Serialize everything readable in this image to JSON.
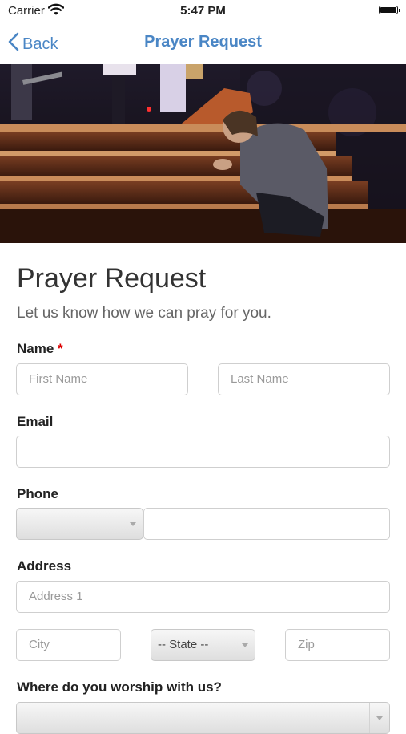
{
  "status_bar": {
    "carrier": "Carrier",
    "time": "5:47 PM"
  },
  "nav": {
    "back_label": "Back",
    "title": "Prayer Request"
  },
  "form": {
    "heading": "Prayer Request",
    "subtitle": "Let us know how we can pray for you.",
    "name": {
      "label": "Name",
      "required_mark": "*",
      "first_placeholder": "First Name",
      "last_placeholder": "Last Name"
    },
    "email": {
      "label": "Email",
      "value": ""
    },
    "phone": {
      "label": "Phone",
      "country_value": "",
      "number_value": ""
    },
    "address": {
      "label": "Address",
      "address1_placeholder": "Address 1",
      "city_placeholder": "City",
      "state_value": "-- State --",
      "zip_placeholder": "Zip"
    },
    "worship": {
      "label": "Where do you worship with us?",
      "value": ""
    }
  }
}
